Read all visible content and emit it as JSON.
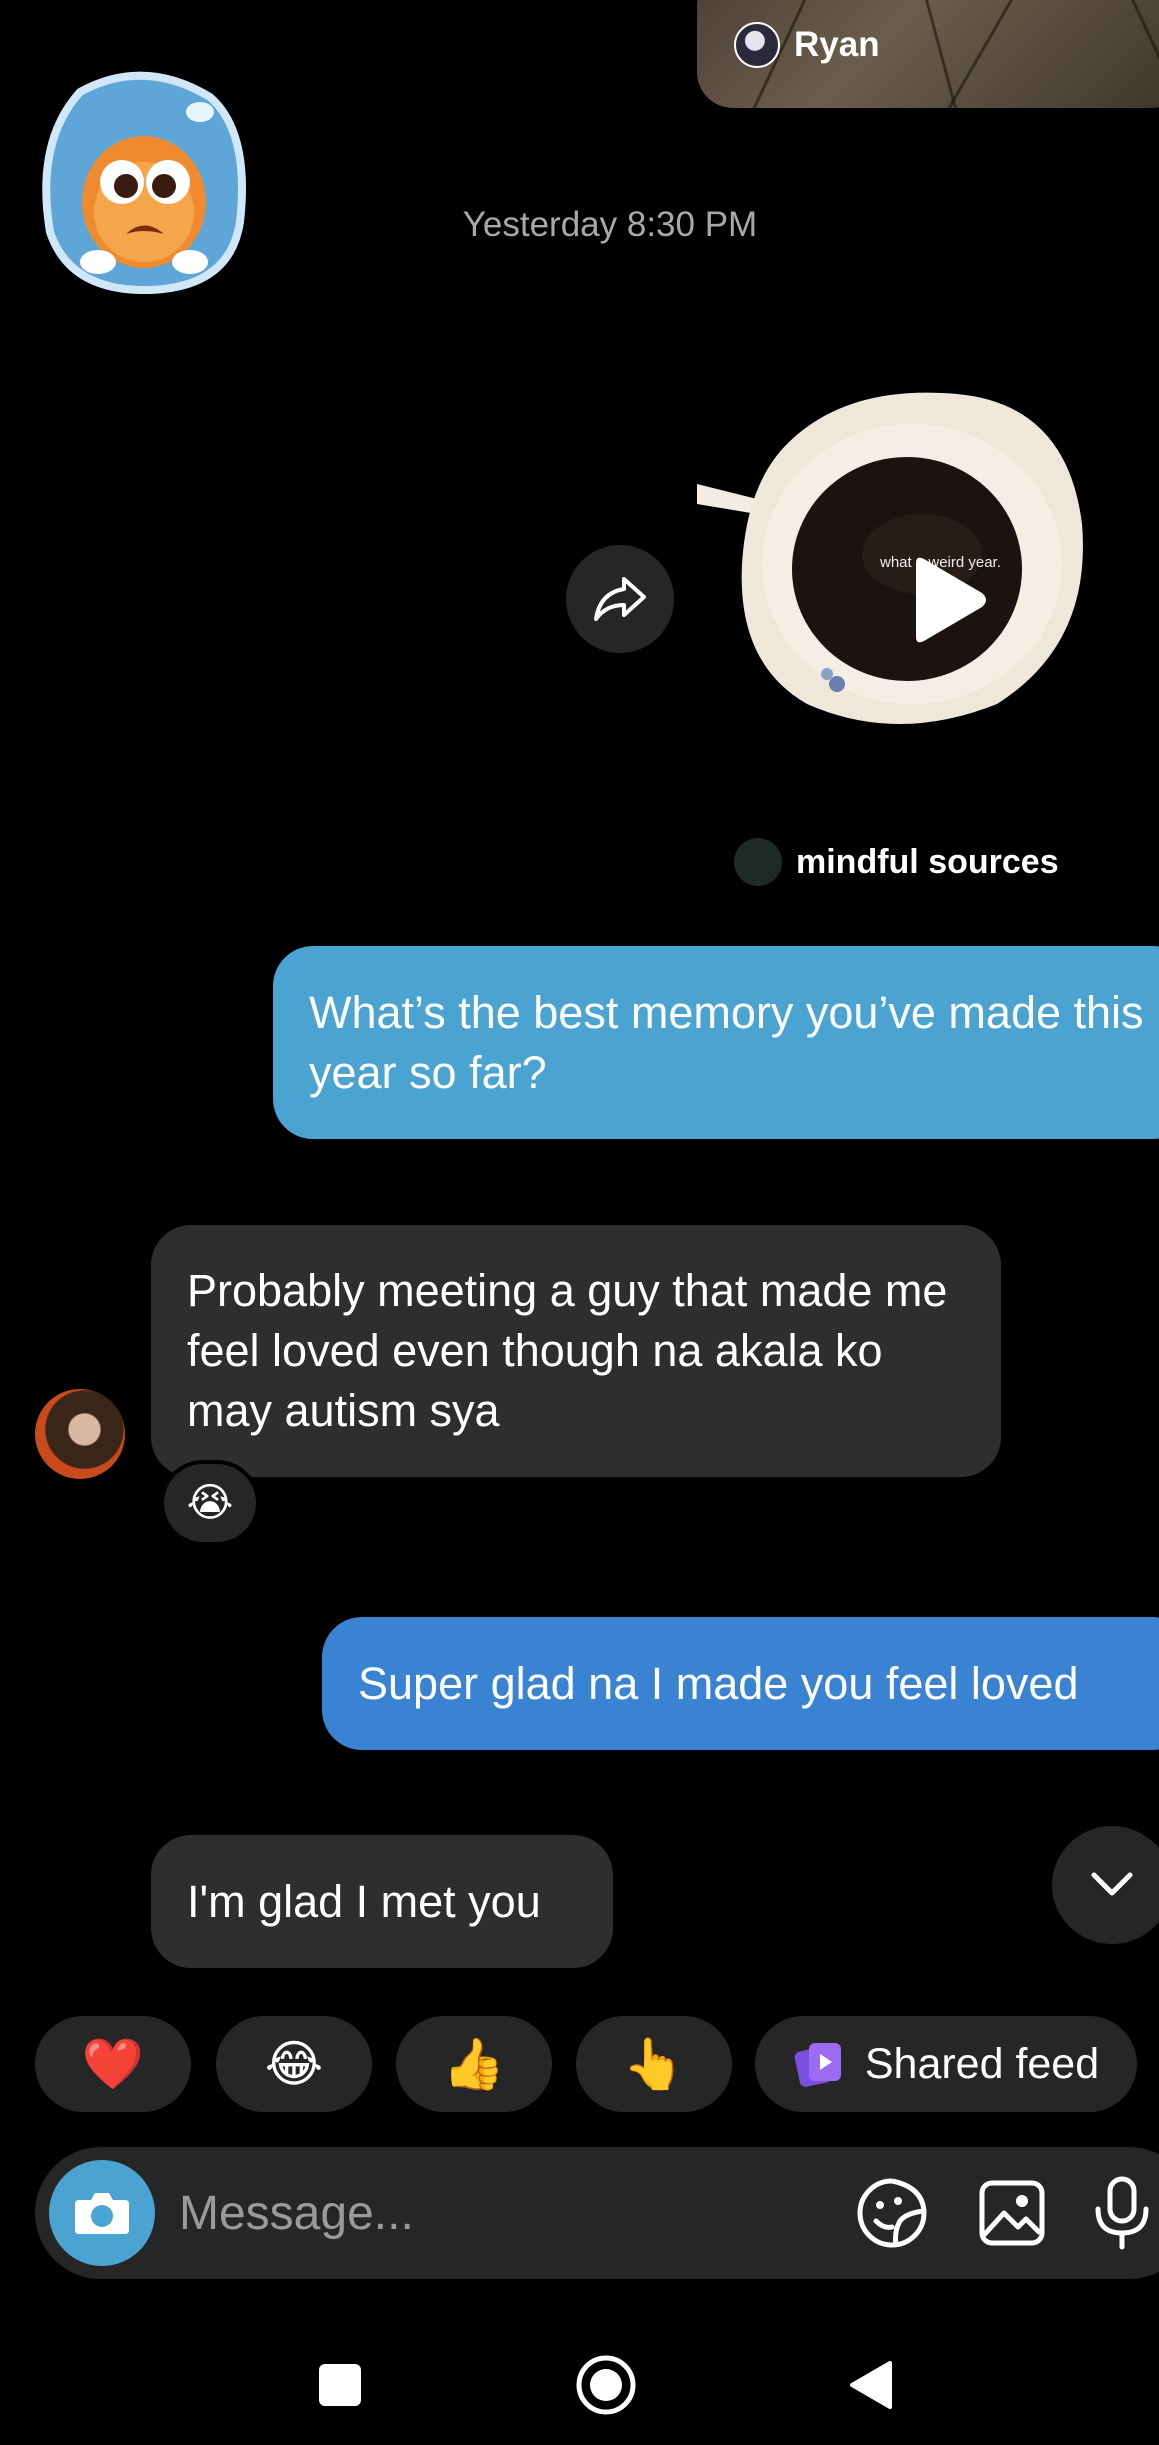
{
  "top_reel": {
    "username": "Ryan"
  },
  "thread": {
    "timestamp": "Yesterday 8:30 PM",
    "shared_reel": {
      "overlay_text": "what a weird year.",
      "source_name": "mindful sources"
    },
    "messages": [
      {
        "direction": "outgoing",
        "text": "What’s the best memory you’ve made this year so far?"
      },
      {
        "direction": "incoming",
        "text": "Probably meeting a guy that made me feel loved even though na akala ko may autism sya",
        "reaction": "😭"
      },
      {
        "direction": "outgoing",
        "text": "Super glad na I made you feel loved"
      },
      {
        "direction": "incoming",
        "text": "I'm glad I met you"
      }
    ]
  },
  "quick_replies": [
    {
      "label": "❤️"
    },
    {
      "label": "😂"
    },
    {
      "label": "👍"
    },
    {
      "label": "👆"
    },
    {
      "label": "Shared feed",
      "icon": "shared-feed-icon"
    }
  ],
  "composer": {
    "placeholder": "Message..."
  },
  "colors": {
    "outgoing_bubble_1": "#4aa3d0",
    "outgoing_bubble_2": "#3a83d3",
    "incoming_bubble": "#2e2e2e",
    "background": "#000000",
    "camera_button": "#4aa3d0"
  }
}
